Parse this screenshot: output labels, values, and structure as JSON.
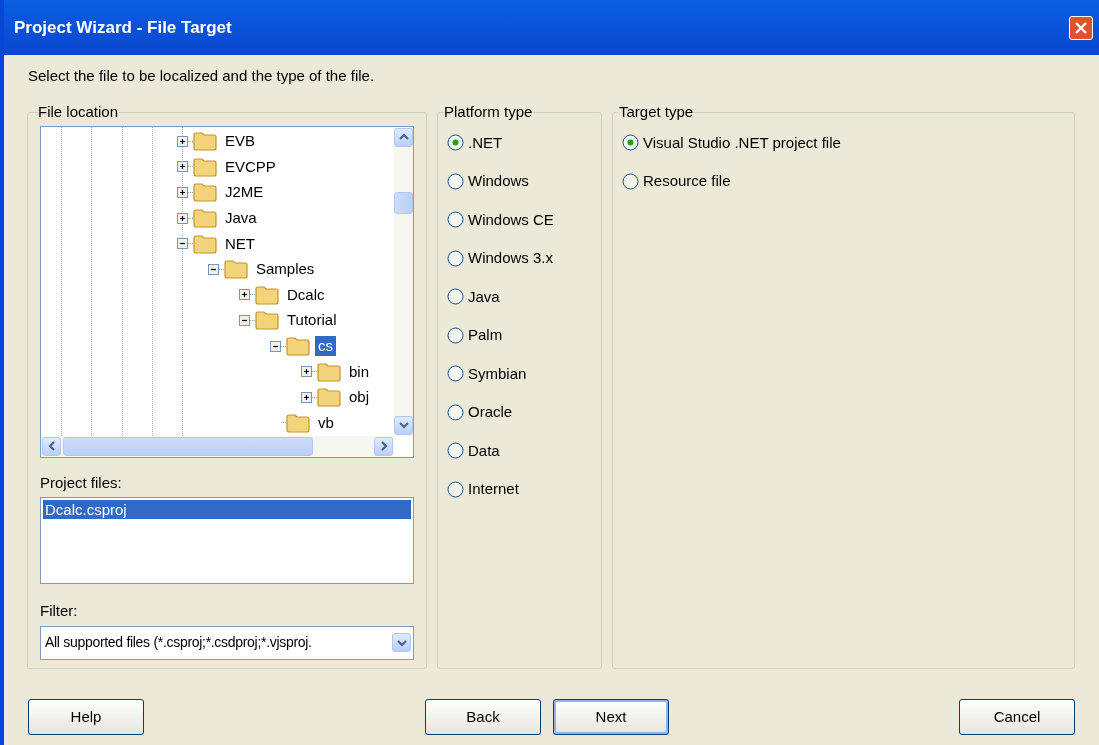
{
  "window": {
    "title": "Project Wizard - File Target"
  },
  "instruction": "Select the file to be localized and the type of the file.",
  "file_location": {
    "title": "File location",
    "tree": [
      {
        "label": "EVB",
        "expanded": false,
        "selected": false
      },
      {
        "label": "EVCPP",
        "expanded": false,
        "selected": false
      },
      {
        "label": "J2ME",
        "expanded": false,
        "selected": false
      },
      {
        "label": "Java",
        "expanded": false,
        "selected": false
      },
      {
        "label": "NET",
        "expanded": true,
        "selected": false,
        "children": [
          {
            "label": "Samples",
            "expanded": true,
            "selected": false,
            "children": [
              {
                "label": "Dcalc",
                "expanded": false,
                "selected": false
              },
              {
                "label": "Tutorial",
                "expanded": true,
                "selected": false,
                "children": [
                  {
                    "label": "cs",
                    "expanded": true,
                    "selected": true,
                    "children": [
                      {
                        "label": "bin",
                        "expanded": false,
                        "selected": false
                      },
                      {
                        "label": "obj",
                        "expanded": false,
                        "selected": false
                      }
                    ]
                  },
                  {
                    "label": "vb",
                    "selected": false
                  }
                ]
              }
            ]
          }
        ]
      }
    ],
    "project_files_label": "Project files:",
    "project_files": [
      {
        "name": "Dcalc.csproj",
        "selected": true
      }
    ],
    "filter_label": "Filter:",
    "filter_value": "All supported files (*.csproj;*.csdproj;*.vjsproj."
  },
  "platform_type": {
    "title": "Platform type",
    "options": [
      {
        "label": ".NET",
        "selected": true
      },
      {
        "label": "Windows",
        "selected": false
      },
      {
        "label": "Windows CE",
        "selected": false
      },
      {
        "label": "Windows 3.x",
        "selected": false
      },
      {
        "label": "Java",
        "selected": false
      },
      {
        "label": "Palm",
        "selected": false
      },
      {
        "label": "Symbian",
        "selected": false
      },
      {
        "label": "Oracle",
        "selected": false
      },
      {
        "label": "Data",
        "selected": false
      },
      {
        "label": "Internet",
        "selected": false
      }
    ]
  },
  "target_type": {
    "title": "Target type",
    "options": [
      {
        "label": "Visual Studio .NET project file",
        "selected": true
      },
      {
        "label": "Resource file",
        "selected": false
      }
    ]
  },
  "buttons": [
    {
      "label": "Help",
      "focused": false
    },
    {
      "label": "Back",
      "focused": false
    },
    {
      "label": "Next",
      "focused": true
    },
    {
      "label": "Cancel",
      "focused": false
    }
  ]
}
